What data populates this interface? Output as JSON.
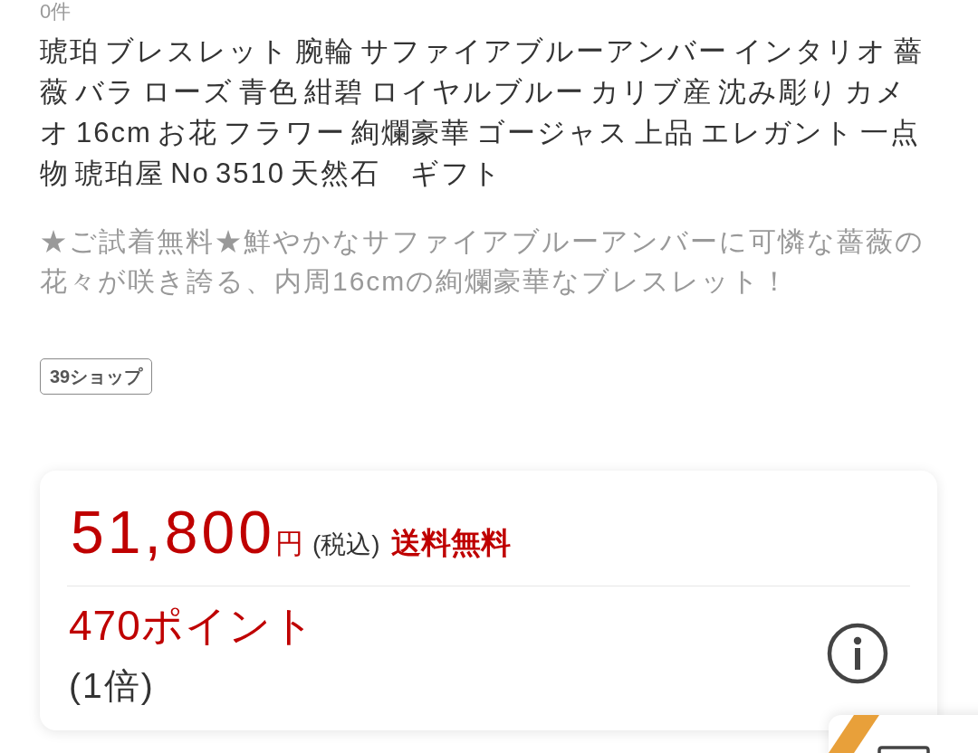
{
  "result_count": "0件",
  "product": {
    "title": "琥珀 ブレスレット 腕輪 サファイアブルーアンバー インタリオ 薔薇 バラ ローズ 青色 紺碧 ロイヤルブルー カリブ産 沈み彫り カメオ 16cm お花 フラワー 絢爛豪華 ゴージャス 上品 エレガント 一点物 琥珀屋 No 3510 天然石　ギフト",
    "catch_copy": "★ご試着無料★鮮やかなサファイアブルーアンバーに可憐な薔薇の花々が咲き誇る、内周16cmの絢爛豪華なブレスレット！",
    "shop_badge": "39ショップ"
  },
  "price_card": {
    "price": "51,800",
    "currency": "円",
    "tax_note": "(税込)",
    "shipping": "送料無料",
    "points": "470ポイント",
    "multiplier": "(1倍)"
  }
}
